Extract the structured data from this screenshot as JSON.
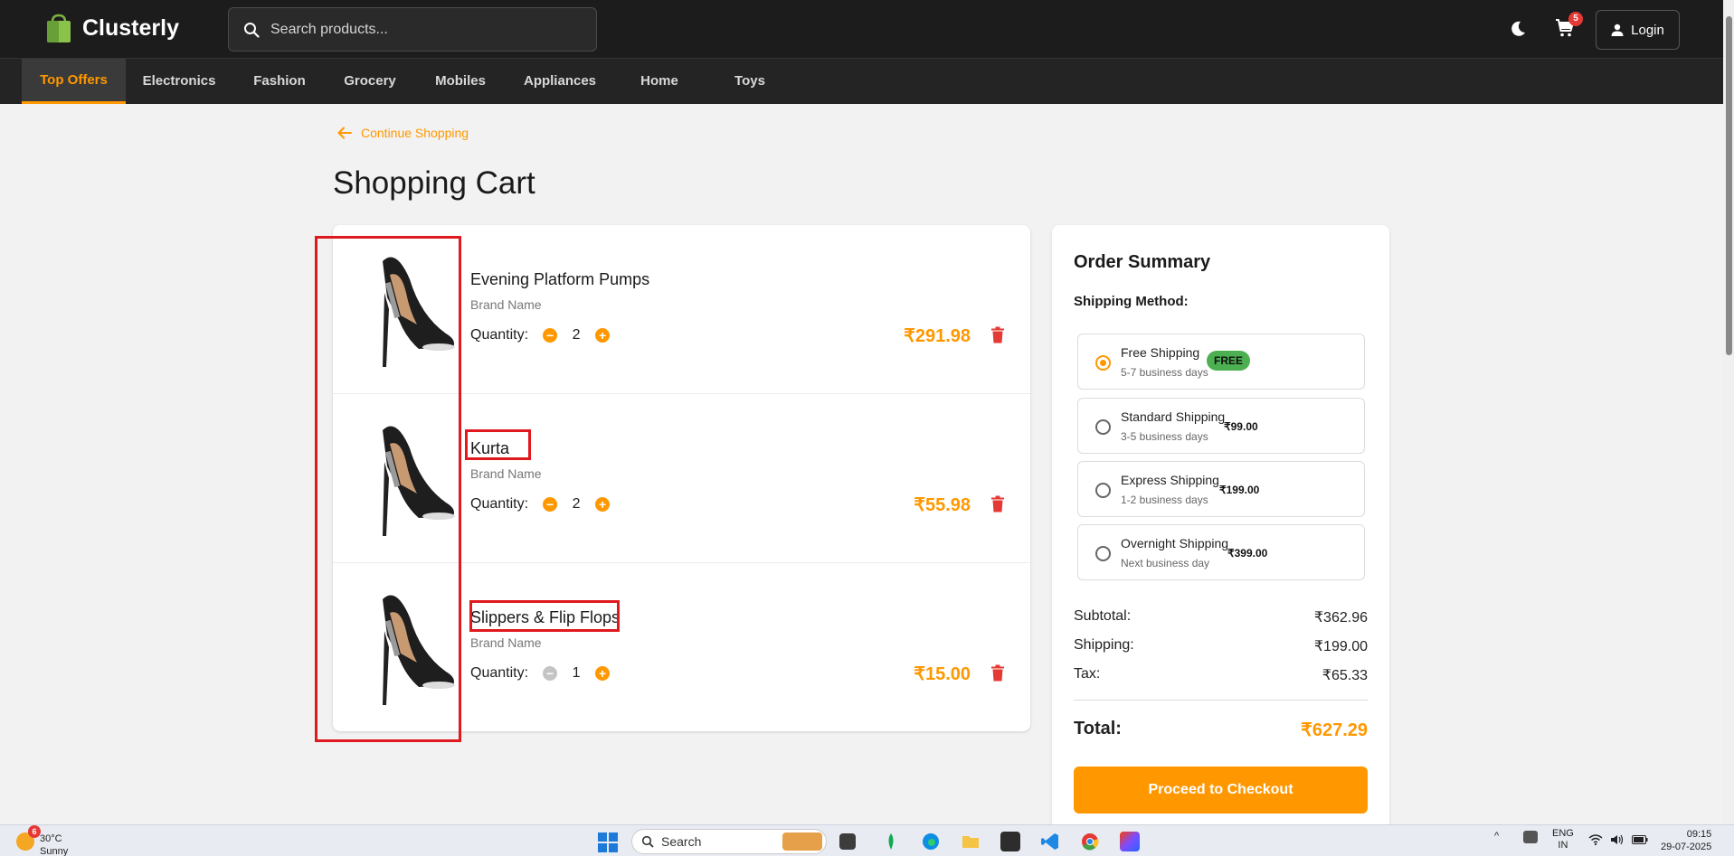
{
  "header": {
    "brand": "Clusterly",
    "search_placeholder": "Search products...",
    "cart_count": "5",
    "login_label": "Login"
  },
  "categories": [
    {
      "label": "Top Offers",
      "active": true
    },
    {
      "label": "Electronics"
    },
    {
      "label": "Fashion"
    },
    {
      "label": "Grocery"
    },
    {
      "label": "Mobiles"
    },
    {
      "label": "Appliances"
    },
    {
      "label": "Home"
    },
    {
      "label": "Toys"
    }
  ],
  "page": {
    "back_label": "Continue Shopping",
    "title": "Shopping Cart"
  },
  "cart": {
    "quantity_label": "Quantity:",
    "items": [
      {
        "name": "Evening Platform Pumps",
        "brand": "Brand Name",
        "quantity": "2",
        "price": "₹291.98"
      },
      {
        "name": "Kurta",
        "brand": "Brand Name",
        "quantity": "2",
        "price": "₹55.98"
      },
      {
        "name": "Slippers & Flip Flops",
        "brand": "Brand Name",
        "quantity": "1",
        "price": "₹15.00"
      }
    ]
  },
  "summary": {
    "title": "Order Summary",
    "shipping_heading": "Shipping Method:",
    "options": [
      {
        "name": "Free Shipping",
        "days": "5-7 business days",
        "price": "FREE",
        "selected": true
      },
      {
        "name": "Standard Shipping",
        "days": "3-5 business days",
        "price": "₹99.00"
      },
      {
        "name": "Express Shipping",
        "days": "1-2 business days",
        "price": "₹199.00"
      },
      {
        "name": "Overnight Shipping",
        "days": "Next business day",
        "price": "₹399.00"
      }
    ],
    "subtotal_label": "Subtotal:",
    "subtotal": "₹362.96",
    "shipping_label": "Shipping:",
    "shipping": "₹199.00",
    "tax_label": "Tax:",
    "tax": "₹65.33",
    "total_label": "Total:",
    "total": "₹627.29",
    "checkout_label": "Proceed to Checkout"
  },
  "colors": {
    "accent": "#ff9800",
    "header_bg": "#1c1c1c",
    "danger": "#e53935",
    "success": "#4caf50"
  },
  "taskbar": {
    "weather_temp": "30°C",
    "weather_desc": "Sunny",
    "weather_badge": "6",
    "search_label": "Search",
    "lang_line1": "ENG",
    "lang_line2": "IN",
    "time": "09:15",
    "date": "29-07-2025"
  }
}
